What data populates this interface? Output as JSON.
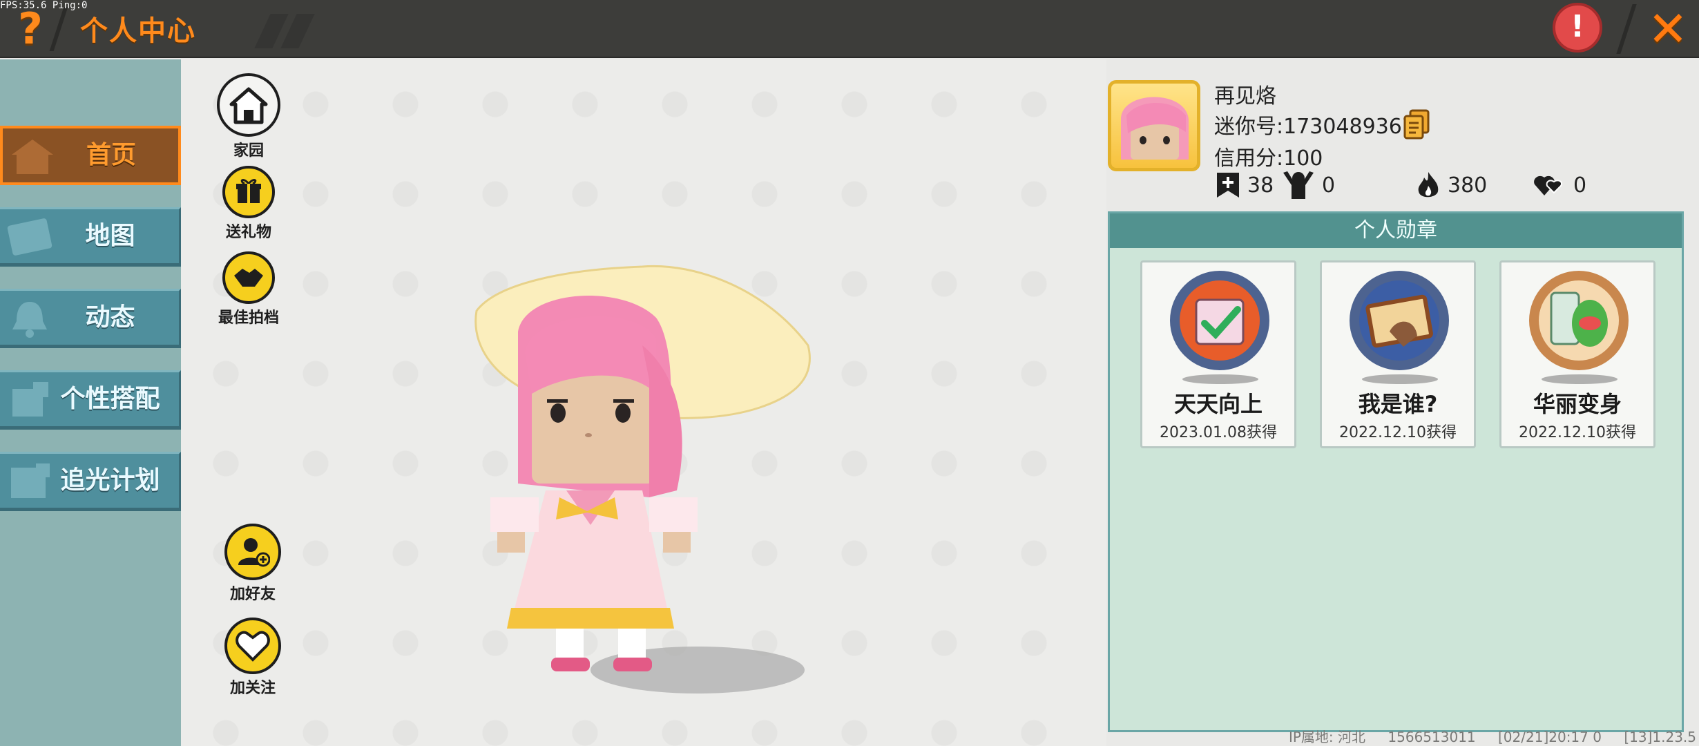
{
  "overlay": {
    "fps": "FPS:35.6  Ping:0"
  },
  "header": {
    "title": "个人中心",
    "help_glyph": "?",
    "report_glyph": "!",
    "close_glyph": "✕"
  },
  "sidebar": {
    "items": [
      {
        "label": "首页",
        "icon": "house-icon",
        "active": true
      },
      {
        "label": "地图",
        "icon": "map-icon",
        "active": false
      },
      {
        "label": "动态",
        "icon": "bell-icon",
        "active": false
      },
      {
        "label": "个性搭配",
        "icon": "outfit-icon",
        "active": false
      },
      {
        "label": "追光计划",
        "icon": "light-plan-icon",
        "active": false
      }
    ]
  },
  "actions": {
    "home": "家园",
    "gift": "送礼物",
    "partner": "最佳拍档",
    "add_friend": "加好友",
    "follow": "加关注"
  },
  "profile": {
    "name": "再见烙",
    "mini_id": "迷你号:1730489367",
    "credit": "信用分:100",
    "stats": {
      "posts": "38",
      "followers": "0",
      "popularity": "380",
      "likes": "0"
    }
  },
  "badges": {
    "title": "个人勋章",
    "items": [
      {
        "name": "天天向上",
        "date": "2023.01.08获得",
        "icon": "calendar-check-medal-icon"
      },
      {
        "name": "我是谁?",
        "date": "2022.12.10获得",
        "icon": "postcard-medal-icon"
      },
      {
        "name": "华丽变身",
        "date": "2022.12.10获得",
        "icon": "dino-costume-medal-icon"
      }
    ]
  },
  "footer": {
    "ip": "IP属地: 河北",
    "uid": "1566513011",
    "timestamp": "[02/21]20:17 0",
    "version": "[13]1.23.5"
  },
  "colors": {
    "accent_orange": "#ff8a1c",
    "nav_teal": "#4f8f9d",
    "panel_green": "#cde5d8",
    "header_teal": "#52928f"
  }
}
